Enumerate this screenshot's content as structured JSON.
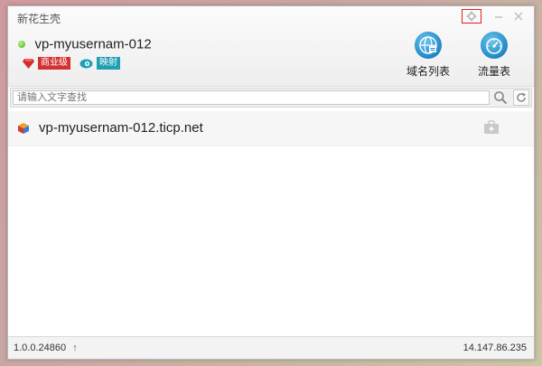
{
  "window": {
    "title": "新花生壳"
  },
  "account": {
    "name": "vp-myusernam-012",
    "status_color": "#4caf1f"
  },
  "badges": {
    "level": "商业级",
    "mapping": "映射"
  },
  "toolbar": {
    "domain_list": "域名列表",
    "traffic": "流量表"
  },
  "search": {
    "placeholder": "请输入文字查找"
  },
  "domains": [
    {
      "name": "vp-myusernam-012.ticp.net"
    }
  ],
  "footer": {
    "version": "1.0.0.24860",
    "ip": "14.147.86.235"
  },
  "colors": {
    "accent": "#1f87c6",
    "badge_red": "#d43232",
    "badge_teal": "#1e9fb3",
    "highlight": "#e02020"
  },
  "icons": [
    "settings-icon",
    "minimize-icon",
    "close-icon",
    "globe-icon",
    "gauge-icon",
    "search-icon",
    "refresh-icon",
    "gem-icon",
    "eye-icon",
    "cube-icon",
    "toolbox-icon",
    "arrow-up-icon"
  ]
}
